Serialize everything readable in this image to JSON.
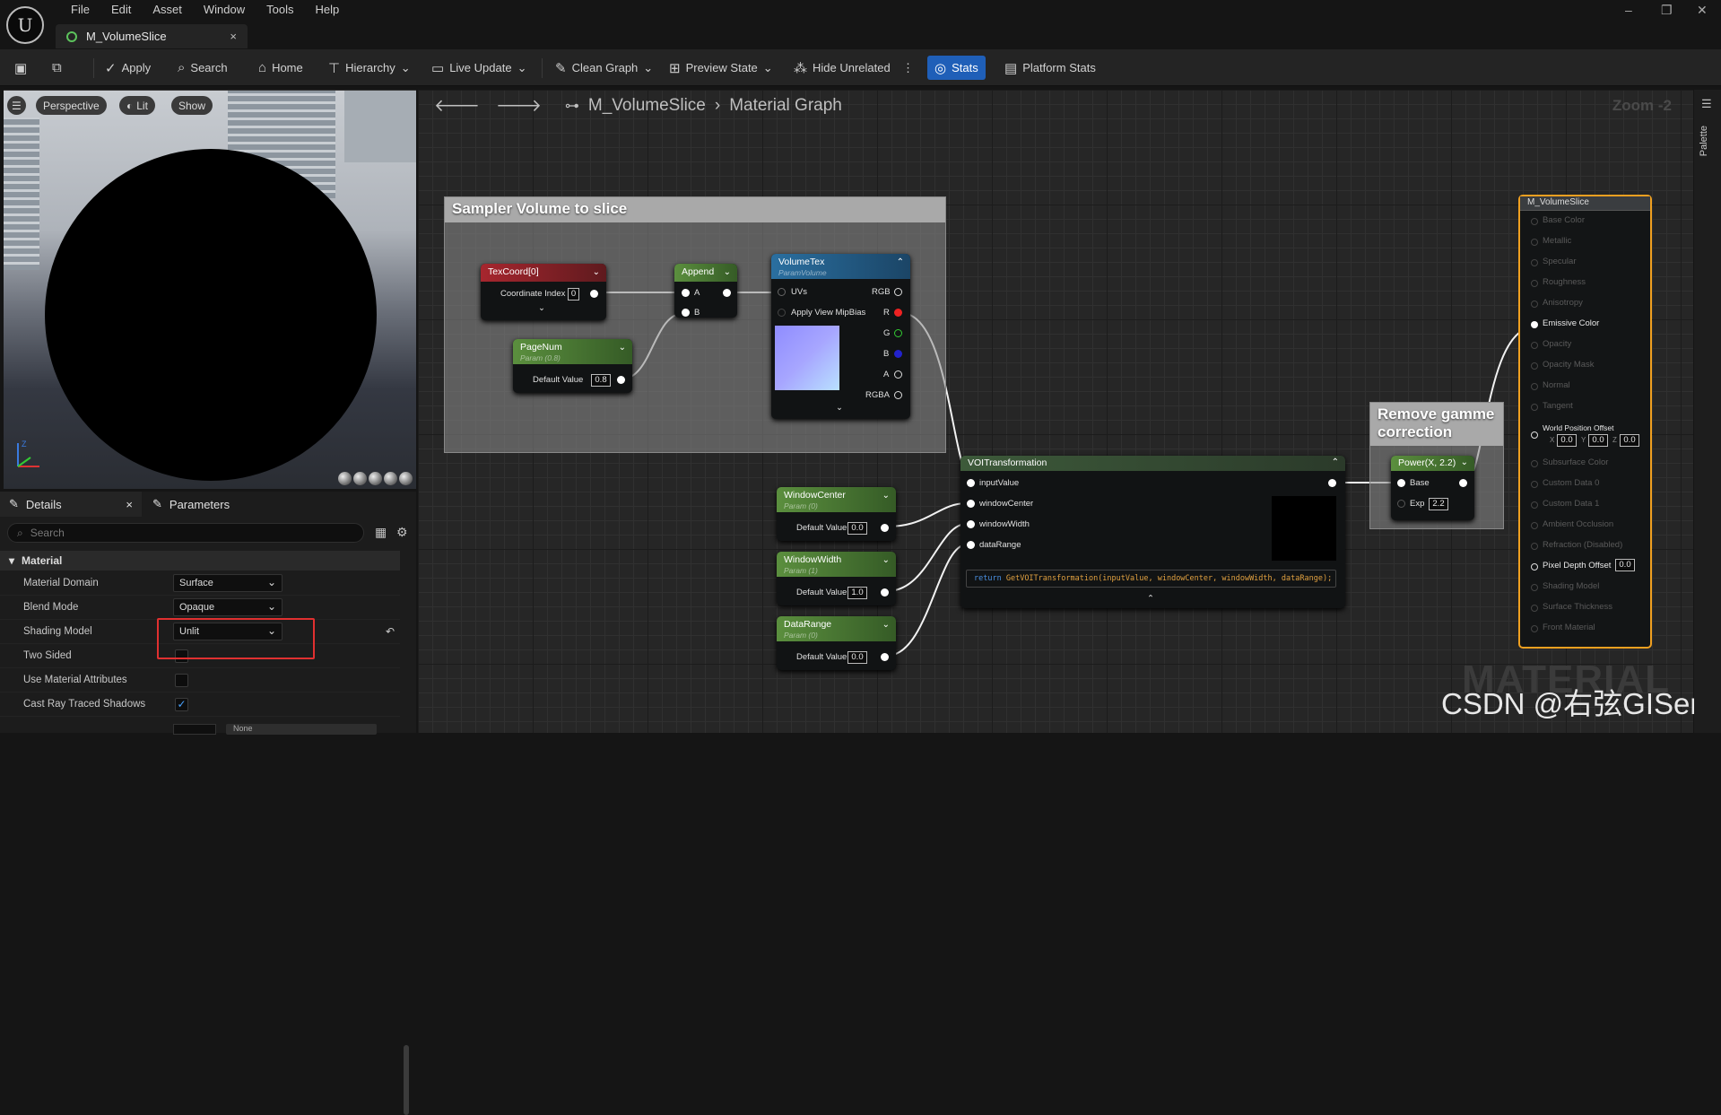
{
  "menu": [
    "File",
    "Edit",
    "Asset",
    "Window",
    "Tools",
    "Help"
  ],
  "window_controls": [
    "–",
    "❐",
    "✕"
  ],
  "document_tab": {
    "title": "M_VolumeSlice",
    "close": "×"
  },
  "toolbar": {
    "apply": "Apply",
    "search": "Search",
    "home": "Home",
    "hierarchy": "Hierarchy",
    "live_update": "Live Update",
    "clean_graph": "Clean Graph",
    "preview_state": "Preview State",
    "hide_unrelated": "Hide Unrelated",
    "stats": "Stats",
    "platform_stats": "Platform Stats"
  },
  "viewport": {
    "perspective": "Perspective",
    "lit": "Lit",
    "show": "Show"
  },
  "details": {
    "tab_details": "Details",
    "tab_parameters": "Parameters",
    "search_placeholder": "Search",
    "category": "Material",
    "rows": [
      {
        "label": "Material Domain",
        "value": "Surface"
      },
      {
        "label": "Blend Mode",
        "value": "Opaque"
      },
      {
        "label": "Shading Model",
        "value": "Unlit"
      },
      {
        "label": "Two Sided",
        "checked": false
      },
      {
        "label": "Use Material Attributes",
        "checked": false
      },
      {
        "label": "Cast Ray Traced Shadows",
        "checked": true
      }
    ],
    "partial_value": "None"
  },
  "graph": {
    "title": "M_VolumeSlice",
    "section": "Material Graph",
    "zoom": "Zoom -2",
    "palette": "Palette",
    "comment_sampler": "Sampler Volume to slice",
    "comment_gamma": "Remove gamme correction",
    "texcoord": {
      "title": "TexCoord[0]",
      "label": "Coordinate Index",
      "value": "0"
    },
    "append": {
      "title": "Append",
      "a": "A",
      "b": "B"
    },
    "pagenum": {
      "title": "PageNum",
      "sub": "Param (0.8)",
      "label": "Default Value",
      "value": "0.8"
    },
    "volumetex": {
      "title": "VolumeTex",
      "sub": "ParamVolume",
      "uvs": "UVs",
      "mip": "Apply View MipBias",
      "outputs": [
        "RGB",
        "R",
        "G",
        "B",
        "A",
        "RGBA"
      ]
    },
    "windowcenter": {
      "title": "WindowCenter",
      "sub": "Param (0)",
      "label": "Default Value",
      "value": "0.0"
    },
    "windowwidth": {
      "title": "WindowWidth",
      "sub": "Param (1)",
      "label": "Default Value",
      "value": "1.0"
    },
    "datarange": {
      "title": "DataRange",
      "sub": "Param (0)",
      "label": "Default Value",
      "value": "0.0"
    },
    "voi": {
      "title": "VOITransformation",
      "inputs": [
        "inputValue",
        "windowCenter",
        "windowWidth",
        "dataRange"
      ],
      "code_kw": "return",
      "code": "GetVOITransformation(inputValue, windowCenter, windowWidth, dataRange);"
    },
    "power": {
      "title": "Power(X, 2.2)",
      "base": "Base",
      "exp": "Exp",
      "exp_value": "2.2"
    },
    "output": {
      "title": "M_VolumeSlice",
      "rows": [
        "Base Color",
        "Metallic",
        "Specular",
        "Roughness",
        "Anisotropy",
        "Emissive Color",
        "Opacity",
        "Opacity Mask",
        "Normal",
        "Tangent",
        "World Position Offset",
        "Subsurface Color",
        "Custom Data 0",
        "Custom Data 1",
        "Ambient Occlusion",
        "Refraction (Disabled)",
        "Pixel Depth Offset",
        "Shading Model",
        "Surface Thickness",
        "Front Material"
      ],
      "wpo": {
        "x": "0.0",
        "y": "0.0",
        "z": "0.0"
      },
      "pdo": "0.0"
    },
    "watermark": "MATERIAL"
  },
  "credit": "CSDN @右弦GISer",
  "colors": {
    "accent": "#1f5fb8",
    "highlight": "#e03030",
    "output_border": "#f0a020"
  }
}
